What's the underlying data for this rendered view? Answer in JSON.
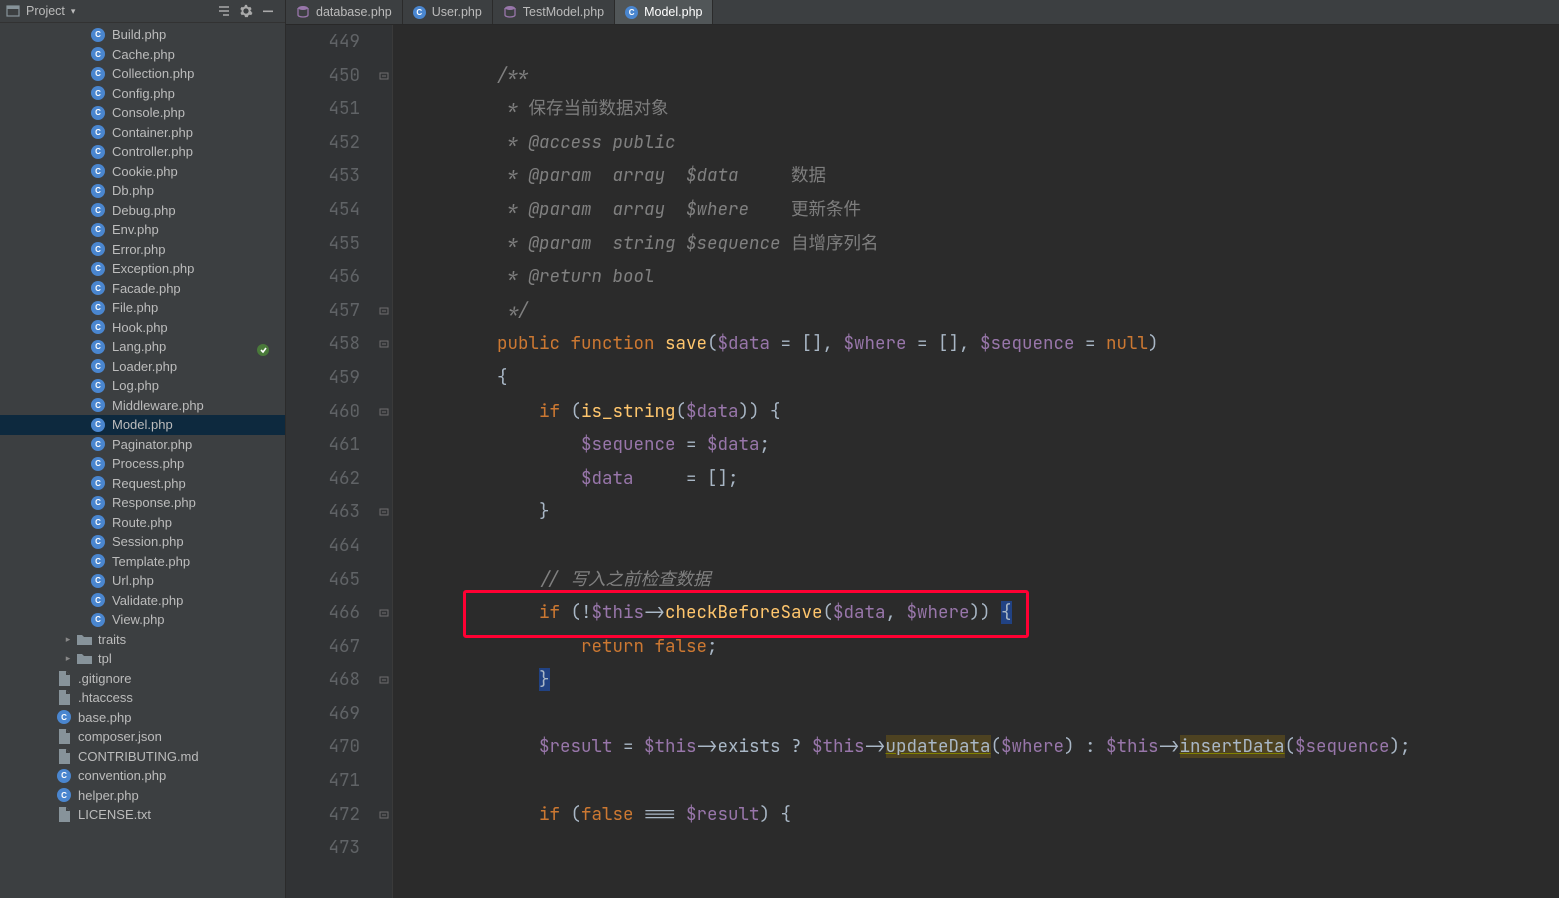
{
  "project_toolbar": {
    "title": "Project",
    "dropdown_chevron": "▾"
  },
  "tree": {
    "php_icon_letter": "C",
    "files_ind0": [
      "Build.php",
      "Cache.php",
      "Collection.php",
      "Config.php",
      "Console.php",
      "Container.php",
      "Controller.php",
      "Cookie.php",
      "Db.php",
      "Debug.php",
      "Env.php",
      "Error.php",
      "Exception.php",
      "Facade.php",
      "File.php",
      "Hook.php",
      "Lang.php",
      "Loader.php",
      "Log.php",
      "Middleware.php",
      "Model.php",
      "Paginator.php",
      "Process.php",
      "Request.php",
      "Response.php",
      "Route.php",
      "Session.php",
      "Template.php",
      "Url.php",
      "Validate.php",
      "View.php"
    ],
    "selected_ind0": "Model.php",
    "folders_ind1": [
      "traits",
      "tpl"
    ],
    "files_ind2_misc": [
      ".gitignore",
      ".htaccess",
      "base.php",
      "composer.json",
      "CONTRIBUTING.md",
      "convention.php",
      "helper.php",
      "LICENSE.txt"
    ]
  },
  "tabs": [
    {
      "label": "database.php",
      "active": false,
      "icon": "db"
    },
    {
      "label": "User.php",
      "active": false,
      "icon": "php"
    },
    {
      "label": "TestModel.php",
      "active": false,
      "icon": "db"
    },
    {
      "label": "Model.php",
      "active": true,
      "icon": "php"
    }
  ],
  "code": {
    "first_line": 449,
    "caret_line": 468,
    "highlight_box": {
      "line": 466,
      "from_col": 0,
      "to_col": 60
    },
    "db_icon_line": 458,
    "lines": [
      "",
      "__CMT__/**",
      "__CMT__ * __PALE__保存当前数据对象",
      "__CMT__ * @access public",
      "__CMT__ * @param  array  $data     __PALE__数据",
      "__CMT__ * @param  array  $where    __PALE__更新条件",
      "__CMT__ * @param  string $sequence __PALE__自增序列名",
      "__CMT__ * @return bool",
      "__CMT__ */",
      "__KW__public __KW__function __FN__save__BR__(__VAR__$data __BR__= [], __VAR__$where __BR__= [], __VAR__$sequence __BR__= __NULL__null__BR__)",
      "__BR__{",
      "    __KW__if __BR__(__FN__is_string__BR__(__VAR__$data__BR__)) {",
      "        __VAR__$sequence __BR__= __VAR__$data__BR__;",
      "        __VAR__$data     __BR__= [];",
      "    __BR__}",
      "",
      "    __CMT__// 写入之前检查数据",
      "    __KW__if __BR__(!__VAR__$this__BR__->__FN__checkBeforeSave__BR__(__VAR__$data__BR__, __VAR__$where__BR__)) __CURS__{",
      "        __KW__return __FALSE__false__BR__;",
      "    __MATCH__}",
      "",
      "    __VAR__$result __BR__= __VAR__$this__BR__->exists ? __VAR__$this__BR__->__WARN__updateData__BR__(__VAR__$where__BR__) : __VAR__$this__BR__->__WARN__insertData__BR__(__VAR__$sequence__BR__);",
      "",
      "    __KW__if __BR__(__FALSE__false __BR__=== __VAR__$result__BR__) {",
      ""
    ],
    "base_indent": 4,
    "fold_marks": [
      450,
      457,
      458,
      460,
      463,
      466,
      468,
      472
    ]
  }
}
